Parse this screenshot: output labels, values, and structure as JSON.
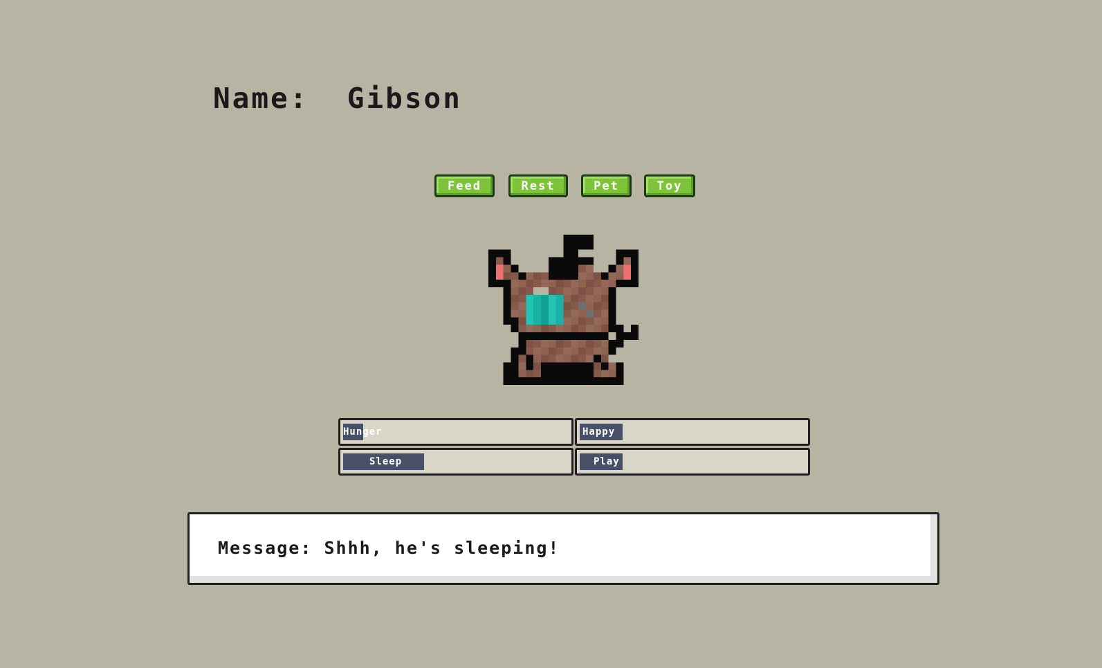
{
  "pet": {
    "name_label": "Name:  Gibson"
  },
  "actions": {
    "feed_label": "Feed",
    "rest_label": "Rest",
    "pet_label": "Pet",
    "toy_label": "Toy"
  },
  "stats": {
    "hunger": {
      "label": "Hunger",
      "level_percent": 9
    },
    "happy": {
      "label": "Happy",
      "level_percent": 19
    },
    "sleep": {
      "label": "Sleep",
      "level_percent": 36
    },
    "play": {
      "label": "Play",
      "level_percent": 19
    }
  },
  "message": {
    "text": "Message: Shhh, he's sleeping!"
  },
  "colors": {
    "background": "#b7b4a4",
    "button_green": "#7ec43a",
    "meter_fill": "#475067",
    "pet_body": "#87594a",
    "pet_collar": "#19b3a6",
    "pet_ear_inner": "#f07070"
  },
  "sprite": {
    "subject": "brown pixel cat with teal collar tag",
    "pixel_rows": [
      "..........OOOO......",
      "..........OOOO......",
      "OOO.......OO.....OOO",
      "ObO.....OOOOOO...ObO",
      "OpbO....OOOObb..ObpO",
      "OpbbObbbOOOObbbObbpO",
      "OOObbbbbbbbbbbbbbOOO",
      "..Obbb..bbbbbbbbO...",
      "..ObbtttttbbbbbbO...",
      "..ObbtttttbbgbbbO...",
      "..ObbtttttbbbgbbO...",
      "..OObtttttbbbbbbO...",
      "...ObbbbbbbbbbbbOO.O",
      "....OOOOOOOOOOOO.OOO",
      "....ObbbbbbbbbbbOO..",
      "...OObbbbbbbbbbbO...",
      "...ObObbbbbbbbOb....",
      "..OObObOOOOOOObObO..",
      "..OObbbOOOOOOObbbO..",
      "..OOOOOOOOOOOOOOOO.."
    ]
  }
}
